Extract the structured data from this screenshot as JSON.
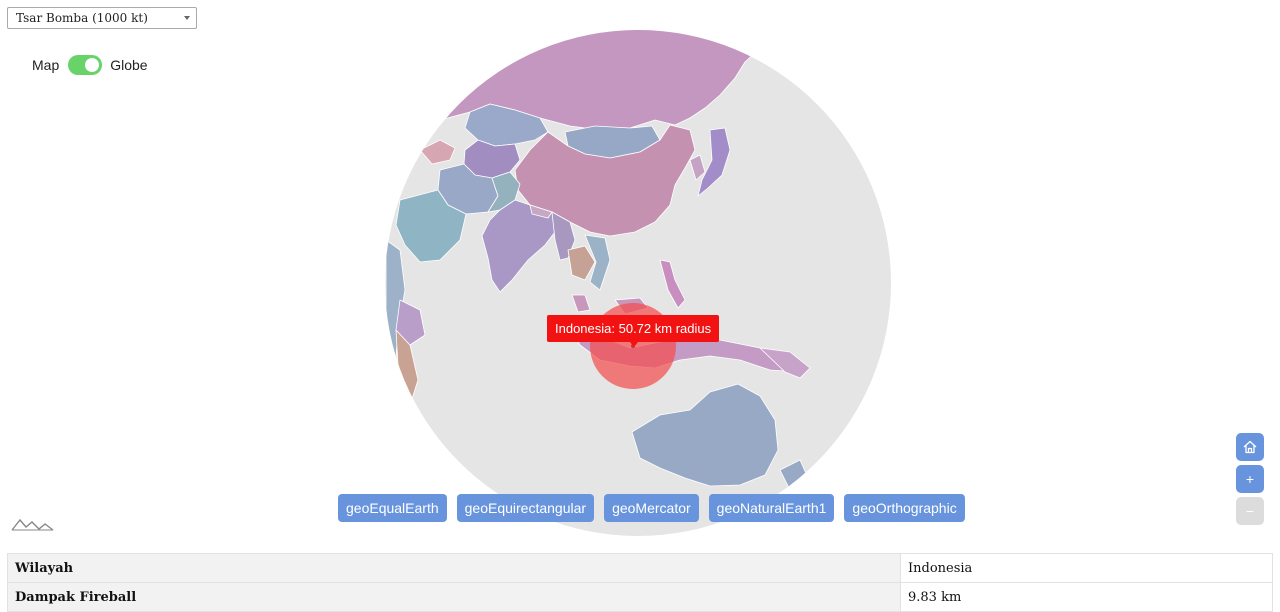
{
  "weapon_select": {
    "selected": "Tsar Bomba (1000 kt)"
  },
  "view_toggle": {
    "left_label": "Map",
    "right_label": "Globe",
    "state": "Globe"
  },
  "map": {
    "focus_region": "Indonesia",
    "colors": {
      "ocean": "#e5e5e5",
      "impact": "#f24e4e",
      "tooltip": "#f21212",
      "accent": "#6794dc"
    },
    "tooltip": "Indonesia: 50.72 km radius"
  },
  "projections": [
    "geoEqualEarth",
    "geoEquirectangular",
    "geoMercator",
    "geoNaturalEarth1",
    "geoOrthographic"
  ],
  "zoom": {
    "home_icon": "home-icon",
    "zoom_in": "+",
    "zoom_out": "−"
  },
  "info_table": [
    {
      "label": "Wilayah",
      "value": "Indonesia"
    },
    {
      "label": "Dampak Fireball",
      "value": "9.83 km"
    }
  ]
}
